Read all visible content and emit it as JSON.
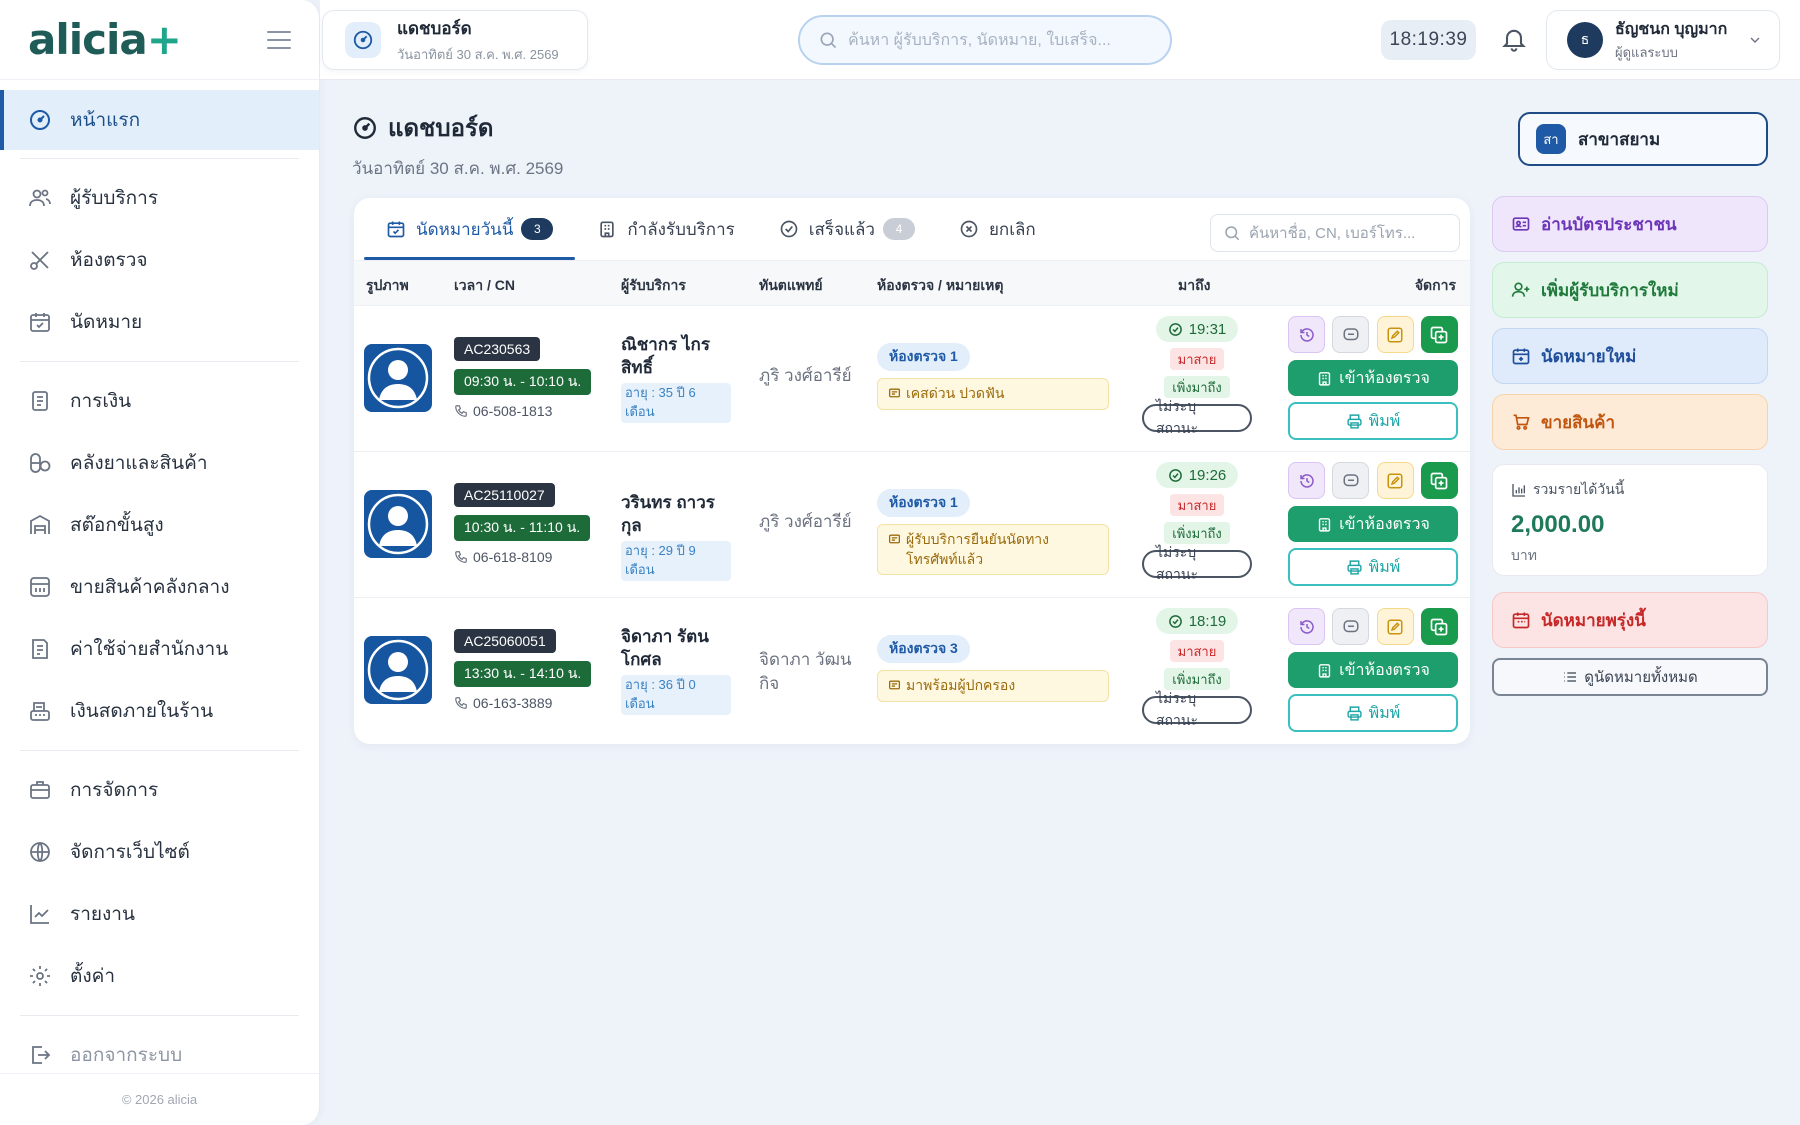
{
  "brand": {
    "name": "alicia",
    "plus": "+"
  },
  "sidebar": {
    "items": [
      {
        "label": "หน้าแรก",
        "icon": "dashboard-icon",
        "active": true
      },
      {
        "label": "ผู้รับบริการ",
        "icon": "users-icon"
      },
      {
        "label": "ห้องตรวจ",
        "icon": "scissors-icon"
      },
      {
        "label": "นัดหมาย",
        "icon": "calendar-check-icon"
      },
      {
        "label": "การเงิน",
        "icon": "document-icon"
      },
      {
        "label": "คลังยาและสินค้า",
        "icon": "pills-icon"
      },
      {
        "label": "สต๊อกขั้นสูง",
        "icon": "warehouse-icon"
      },
      {
        "label": "ขายสินค้าคลังกลาง",
        "icon": "store-icon"
      },
      {
        "label": "ค่าใช้จ่ายสำนักงาน",
        "icon": "receipt-icon"
      },
      {
        "label": "เงินสดภายในร้าน",
        "icon": "cash-register-icon"
      },
      {
        "label": "การจัดการ",
        "icon": "briefcase-icon"
      },
      {
        "label": "จัดการเว็บไซต์",
        "icon": "globe-icon"
      },
      {
        "label": "รายงาน",
        "icon": "chart-line-icon"
      },
      {
        "label": "ตั้งค่า",
        "icon": "gear-icon"
      },
      {
        "label": "ออกจากระบบ",
        "icon": "logout-icon"
      }
    ],
    "footer": "© 2026 alicia"
  },
  "topbar": {
    "page_title": "แดชบอร์ด",
    "page_date": "วันอาทิตย์ 30 ส.ค. พ.ศ. 2569",
    "search_placeholder": "ค้นหา ผู้รับบริการ, นัดหมาย, ใบเสร็จ...",
    "clock": "18:19:39",
    "user": {
      "initial": "ธ",
      "name": "ธัญชนก บุญมาก",
      "role": "ผู้ดูแลระบบ"
    }
  },
  "header": {
    "title": "แดชบอร์ด",
    "date": "วันอาทิตย์ 30 ส.ค. พ.ศ. 2569",
    "branch_badge": "สา",
    "branch_name": "สาขาสยาม"
  },
  "tabs": [
    {
      "label": "นัดหมายวันนี้",
      "count": "3",
      "active": true
    },
    {
      "label": "กำลังรับบริการ"
    },
    {
      "label": "เสร็จแล้ว",
      "count": "4"
    },
    {
      "label": "ยกเลิก"
    }
  ],
  "table_search_placeholder": "ค้นหาชื่อ, CN, เบอร์โทร...",
  "columns": [
    "รูปภาพ",
    "เวลา / CN",
    "ผู้รับบริการ",
    "ทันตแพทย์",
    "ห้องตรวจ / หมายเหตุ",
    "มาถึง",
    "จัดการ"
  ],
  "rows": [
    {
      "cn": "AC230563",
      "time": "09:30 น. - 10:10 น.",
      "phone": "06-508-1813",
      "name": "ณิชากร ไกรสิทธิ์",
      "age": "อายุ : 35 ปี 6 เดือน",
      "dentist": "ภูริ วงศ์อารีย์",
      "room": "ห้องตรวจ 1",
      "note": "เคสด่วน ปวดฟัน",
      "arrival_time": "19:31",
      "late": "มาสาย",
      "just": "เพิ่งมาถึง",
      "status": "ไม่ระบุสถานะ",
      "enter": "เข้าห้องตรวจ",
      "print": "พิมพ์"
    },
    {
      "cn": "AC25110027",
      "time": "10:30 น. - 11:10 น.",
      "phone": "06-618-8109",
      "name": "วรินทร ถาวรกุล",
      "age": "อายุ : 29 ปี 9 เดือน",
      "dentist": "ภูริ วงศ์อารีย์",
      "room": "ห้องตรวจ 1",
      "note": "ผู้รับบริการยืนยันนัดทางโทรศัพท์แล้ว",
      "arrival_time": "19:26",
      "late": "มาสาย",
      "just": "เพิ่งมาถึง",
      "status": "ไม่ระบุสถานะ",
      "enter": "เข้าห้องตรวจ",
      "print": "พิมพ์"
    },
    {
      "cn": "AC25060051",
      "time": "13:30 น. - 14:10 น.",
      "phone": "06-163-3889",
      "name": "จิดาภา รัตนโกศล",
      "age": "อายุ : 36 ปี 0 เดือน",
      "dentist": "จิดาภา วัฒนกิจ",
      "room": "ห้องตรวจ 3",
      "note": "มาพร้อมผู้ปกครอง",
      "arrival_time": "18:19",
      "late": "มาสาย",
      "just": "เพิ่งมาถึง",
      "status": "ไม่ระบุสถานะ",
      "enter": "เข้าห้องตรวจ",
      "print": "พิมพ์"
    }
  ],
  "quick_actions": {
    "read_id": "อ่านบัตรประชาชน",
    "add_patient": "เพิ่มผู้รับบริการใหม่",
    "new_appt": "นัดหมายใหม่",
    "sell": "ขายสินค้า",
    "tomorrow": "นัดหมายพรุ่งนี้",
    "view_all": "ดูนัดหมายทั้งหมด"
  },
  "income": {
    "label": "รวมรายได้วันนี้",
    "value": "2,000.00",
    "unit": "บาท"
  },
  "colors": {
    "primary": "#1f5aa6",
    "success": "#1e9e6d",
    "brand": "#1f5c57"
  }
}
